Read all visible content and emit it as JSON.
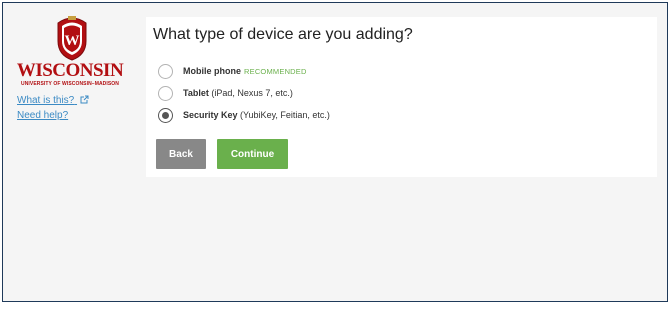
{
  "sidebar": {
    "logo_word": "WISCONSIN",
    "logo_sub": "UNIVERSITY OF WISCONSIN–MADISON",
    "links": [
      {
        "label": "What is this?",
        "icon": "external-link-icon"
      },
      {
        "label": "Need help?"
      }
    ]
  },
  "main": {
    "title": "What type of device are you adding?",
    "options": [
      {
        "name": "Mobile phone",
        "badge": "RECOMMENDED",
        "detail": "",
        "checked": false
      },
      {
        "name": "Tablet",
        "badge": "",
        "detail": "(iPad, Nexus 7, etc.)",
        "checked": false
      },
      {
        "name": "Security Key",
        "badge": "",
        "detail": "(YubiKey, Feitian, etc.)",
        "checked": true
      }
    ],
    "buttons": {
      "back": "Back",
      "continue": "Continue"
    }
  },
  "colors": {
    "brand_red": "#b20f12",
    "accent_green": "#6ab04c",
    "link_blue": "#3b8ac4",
    "back_gray": "#888888"
  }
}
